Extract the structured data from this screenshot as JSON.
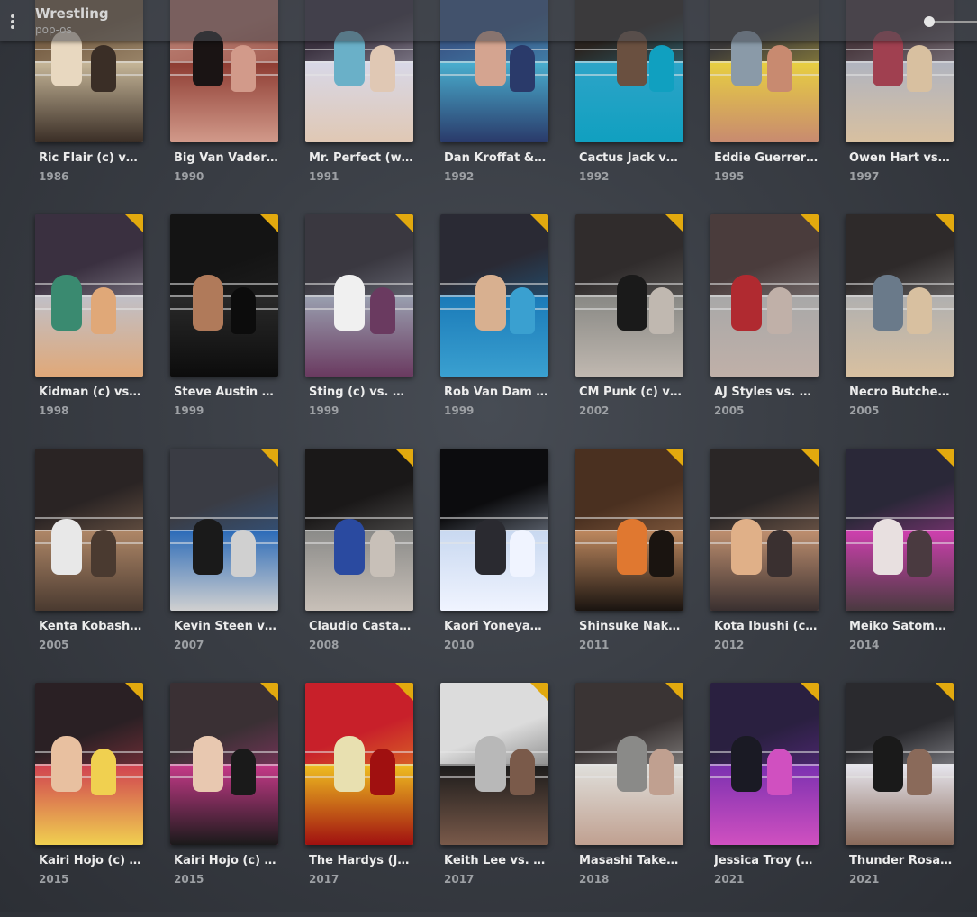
{
  "header": {
    "title": "Wrestling",
    "subtitle": "pop-os"
  },
  "rows": [
    {
      "items": [
        {
          "title": "Ric Flair (c) vs. B…",
          "year": "1986",
          "badge": false,
          "palette": [
            "#7a6248",
            "#c8b89a",
            "#e8d8c0",
            "#3a2e26"
          ]
        },
        {
          "title": "Big Van Vader (c…",
          "year": "1990",
          "badge": false,
          "palette": [
            "#b4766a",
            "#8c3a30",
            "#1a1414",
            "#d29a8a"
          ]
        },
        {
          "title": "Mr. Perfect (w/C…",
          "year": "1991",
          "badge": false,
          "palette": [
            "#3b3240",
            "#d8d8e8",
            "#6ab0c8",
            "#e0c8b4"
          ]
        },
        {
          "title": "Dan Kroffat & D…",
          "year": "1992",
          "badge": false,
          "palette": [
            "#3a5a8a",
            "#4ab0d0",
            "#d4a490",
            "#2a3a6a"
          ]
        },
        {
          "title": "Cactus Jack vs. S…",
          "year": "1992",
          "badge": false,
          "palette": [
            "#2a2420",
            "#2ea4c8",
            "#6a5040",
            "#10a0c0"
          ]
        },
        {
          "title": "Eddie Guerrero …",
          "year": "1995",
          "badge": false,
          "palette": [
            "#3a3838",
            "#e8d040",
            "#8a9aa8",
            "#c88a70"
          ]
        },
        {
          "title": "Owen Hart vs. T…",
          "year": "1997",
          "badge": false,
          "palette": [
            "#4a3a40",
            "#b0b4c0",
            "#a04050",
            "#d8c0a0"
          ]
        }
      ]
    },
    {
      "items": [
        {
          "title": "Kidman (c) vs. R…",
          "year": "1998",
          "badge": true,
          "palette": [
            "#3a3040",
            "#c0c0c8",
            "#3a8a70",
            "#e0a878"
          ]
        },
        {
          "title": "Steve Austin (c) …",
          "year": "1999",
          "badge": true,
          "palette": [
            "#141414",
            "#2a2a2a",
            "#b07a5a",
            "#0c0c0c"
          ]
        },
        {
          "title": "Sting (c) vs. Dia…",
          "year": "1999",
          "badge": true,
          "palette": [
            "#3a3840",
            "#9aa0b0",
            "#f0f0f0",
            "#6a3a60"
          ]
        },
        {
          "title": "Rob Van Dam (c…",
          "year": "1999",
          "badge": true,
          "palette": [
            "#2a2a34",
            "#1a7ab8",
            "#d8b090",
            "#3aa0d0"
          ]
        },
        {
          "title": "CM Punk (c) vs. …",
          "year": "2002",
          "badge": true,
          "palette": [
            "#302c2c",
            "#888884",
            "#1a1a1a",
            "#c0b8b0"
          ]
        },
        {
          "title": "AJ Styles vs. Aby…",
          "year": "2005",
          "badge": true,
          "palette": [
            "#4a3c3c",
            "#a8a8a8",
            "#b02a30",
            "#c0b0a8"
          ]
        },
        {
          "title": "Necro Butcher v…",
          "year": "2005",
          "badge": true,
          "palette": [
            "#2e2a2a",
            "#b0b0b0",
            "#6a7a8a",
            "#d8c0a0"
          ]
        }
      ]
    },
    {
      "items": [
        {
          "title": "Kenta Kobashi v…",
          "year": "2005",
          "badge": false,
          "palette": [
            "#2a2424",
            "#b08868",
            "#e8e8e8",
            "#4a3a30"
          ]
        },
        {
          "title": "Kevin Steen vs. …",
          "year": "2007",
          "badge": true,
          "palette": [
            "#3a3c44",
            "#2a6ab8",
            "#1a1a1a",
            "#d0d0d0"
          ]
        },
        {
          "title": "Claudio Castagn…",
          "year": "2008",
          "badge": true,
          "palette": [
            "#1a1818",
            "#8a8a88",
            "#2a4aa0",
            "#c8c0b8"
          ]
        },
        {
          "title": "Kaori Yoneyama…",
          "year": "2010",
          "badge": false,
          "palette": [
            "#0c0c0e",
            "#c8d8f0",
            "#2a2a30",
            "#f0f4ff"
          ]
        },
        {
          "title": "Shinsuke Naka…",
          "year": "2011",
          "badge": true,
          "palette": [
            "#4a3020",
            "#c08a60",
            "#e07830",
            "#1a1410"
          ]
        },
        {
          "title": "Kota Ibushi (c) v…",
          "year": "2012",
          "badge": true,
          "palette": [
            "#2a2626",
            "#c09070",
            "#e0b088",
            "#3a3030"
          ]
        },
        {
          "title": "Meiko Satomur…",
          "year": "2014",
          "badge": true,
          "palette": [
            "#2a2838",
            "#d040b0",
            "#e8e0e0",
            "#4a3a40"
          ]
        }
      ]
    },
    {
      "items": [
        {
          "title": "Kairi Hojo (c) vs.…",
          "year": "2015",
          "badge": true,
          "palette": [
            "#2a2024",
            "#d04050",
            "#e8c0a0",
            "#f0d050"
          ]
        },
        {
          "title": "Kairi Hojo (c) vs.…",
          "year": "2015",
          "badge": true,
          "palette": [
            "#3a3034",
            "#c83a8a",
            "#e8c8b0",
            "#1a1a1a"
          ]
        },
        {
          "title": "The Hardys (Jeff…",
          "year": "2017",
          "badge": true,
          "palette": [
            "#c8202a",
            "#f0c020",
            "#e8e0b0",
            "#a01010"
          ]
        },
        {
          "title": "Keith Lee vs. Do…",
          "year": "2017",
          "badge": true,
          "palette": [
            "#dcdcdc",
            "#1a1a1a",
            "#b8b8b8",
            "#7a5a4a"
          ]
        },
        {
          "title": "Masashi Takeda…",
          "year": "2018",
          "badge": true,
          "palette": [
            "#3a3434",
            "#e0e0dc",
            "#8a8a88",
            "#c0a090"
          ]
        },
        {
          "title": "Jessica Troy (c) v…",
          "year": "2021",
          "badge": true,
          "palette": [
            "#2a2040",
            "#7a30b0",
            "#1a1a24",
            "#d050c0"
          ]
        },
        {
          "title": "Thunder Rosa v…",
          "year": "2021",
          "badge": true,
          "palette": [
            "#2a2a2e",
            "#e8e8f0",
            "#1a1a1a",
            "#8a6a5a"
          ]
        }
      ]
    }
  ]
}
